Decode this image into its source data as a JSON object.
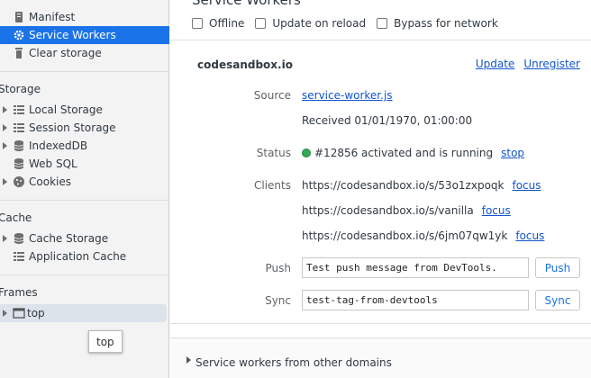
{
  "sidebar": {
    "application_items": [
      {
        "label": "Manifest",
        "icon": "manifest-icon"
      },
      {
        "label": "Service Workers",
        "icon": "gear-icon",
        "selected": true
      },
      {
        "label": "Clear storage",
        "icon": "trash-icon"
      }
    ],
    "storage_title": "Storage",
    "storage_items": [
      {
        "label": "Local Storage",
        "icon": "grid-icon"
      },
      {
        "label": "Session Storage",
        "icon": "grid-icon"
      },
      {
        "label": "IndexedDB",
        "icon": "database-icon"
      },
      {
        "label": "Web SQL",
        "icon": "database-icon"
      },
      {
        "label": "Cookies",
        "icon": "cookie-icon"
      }
    ],
    "cache_title": "Cache",
    "cache_items": [
      {
        "label": "Cache Storage",
        "icon": "database-icon"
      },
      {
        "label": "Application Cache",
        "icon": "grid-icon"
      }
    ],
    "frames_title": "Frames",
    "frames_items": [
      {
        "label": "top",
        "icon": "frame-icon"
      }
    ],
    "tooltip": "top"
  },
  "main": {
    "heading": "Service Workers",
    "options": [
      "Offline",
      "Update on reload",
      "Bypass for network"
    ],
    "origin": "codesandbox.io",
    "update_link": "Update",
    "unregister_link": "Unregister",
    "source_label": "Source",
    "source_link": "service-worker.js",
    "received": "Received 01/01/1970, 01:00:00",
    "status_label": "Status",
    "status_text": "#12856 activated and is running",
    "status_color": "#34a853",
    "stop_link": "stop",
    "clients_label": "Clients",
    "clients": [
      {
        "url": "https://codesandbox.io/s/53o1zxpoqk",
        "action": "focus"
      },
      {
        "url": "https://codesandbox.io/s/vanilla",
        "action": "focus"
      },
      {
        "url": "https://codesandbox.io/s/6jm07qw1yk",
        "action": "focus"
      }
    ],
    "push_label": "Push",
    "push_value": "Test push message from DevTools.",
    "push_button": "Push",
    "sync_label": "Sync",
    "sync_value": "test-tag-from-devtools",
    "sync_button": "Sync",
    "other_domains": "Service workers from other domains"
  }
}
